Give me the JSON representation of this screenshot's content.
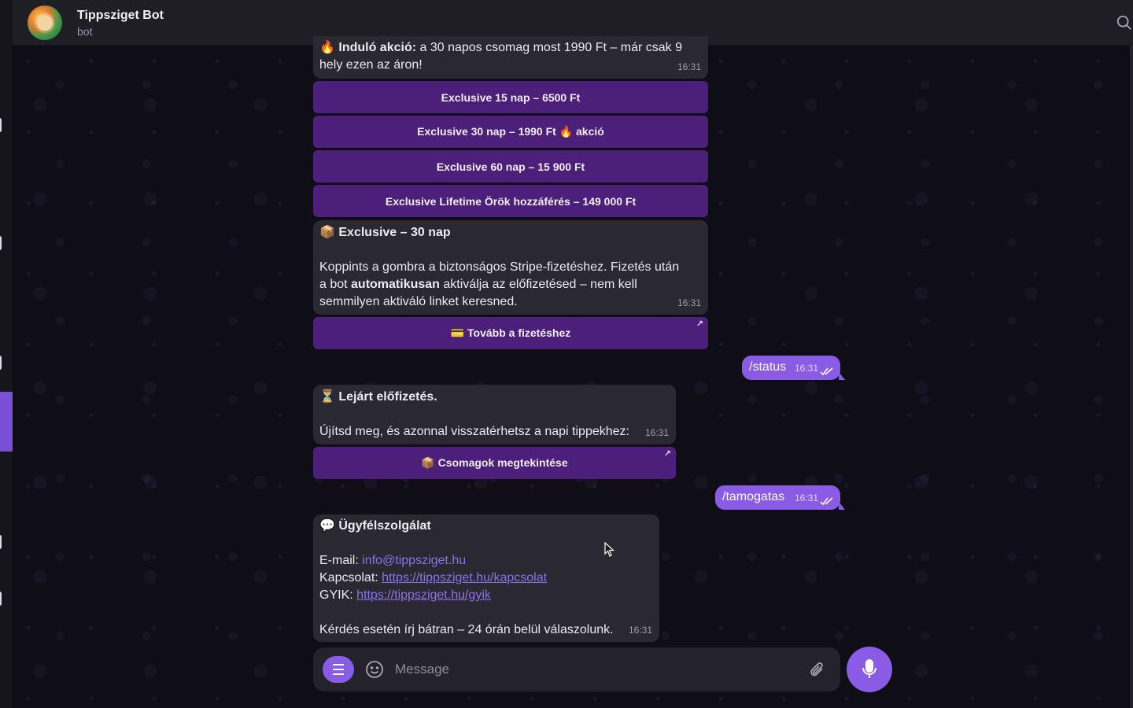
{
  "header": {
    "title": "Tippsziget Bot",
    "subtitle": "bot"
  },
  "messages": {
    "promo": {
      "icon": "🔥",
      "lead": "Induló akció:",
      "line1_rest": " a 30 napos csomag most 1990 Ft – már csak 9",
      "line2": "hely ezen az áron!",
      "time": "16:31"
    },
    "package_buttons": [
      {
        "label": "Exclusive 15 nap – 6500 Ft"
      },
      {
        "label": "Exclusive 30 nap – 1990 Ft 🔥 akció"
      },
      {
        "label": "Exclusive 60 nap – 15 900 Ft"
      },
      {
        "label": "Exclusive Lifetime Örök hozzáférés – 149 000 Ft"
      }
    ],
    "exclusive": {
      "icon": "📦",
      "title": "Exclusive – 30 nap",
      "line1": "Koppints a gombra a biztonságos Stripe-fizetéshez. Fizetés után",
      "line2_pre": "a bot ",
      "line2_bold": "automatikusan",
      "line2_post": " aktiválja az előfizetésed – nem kell",
      "line3": "semmilyen aktiváló linket keresned.",
      "time": "16:31",
      "button": "💳 Tovább a fizetéshez"
    },
    "status_cmd": {
      "text": "/status",
      "time": "16:31"
    },
    "expired": {
      "icon": "⏳",
      "title": "Lejárt előfizetés.",
      "body": "Újítsd meg, és azonnal visszatérhetsz a napi tippekhez:",
      "time": "16:31",
      "button": "📦 Csomagok megtekintése"
    },
    "support_cmd": {
      "text": "/tamogatas",
      "time": "16:31"
    },
    "support": {
      "icon": "💬",
      "title": "Ügyfélszolgálat",
      "email_label": "E-mail: ",
      "email": "info@tippsziget.hu",
      "contact_label": "Kapcsolat: ",
      "contact_url": "https://tippsziget.hu/kapcsolat",
      "faq_label": "GYIK: ",
      "faq_url": "https://tippsziget.hu/gyik",
      "footer": "Kérdés esetén írj bátran – 24 órán belül válaszolunk.",
      "time": "16:31"
    }
  },
  "composer": {
    "placeholder": "Message"
  },
  "colors": {
    "accent": "#8a5ce6",
    "inline_button": "#4b1f7a",
    "incoming_bubble": "#2a2830",
    "link": "#8d72ec",
    "header": "#1f1e24"
  },
  "icons": [
    "search-icon",
    "menu-icon",
    "emoji-icon",
    "attach-icon",
    "mic-icon",
    "double-check-icon",
    "external-arrow-icon"
  ]
}
